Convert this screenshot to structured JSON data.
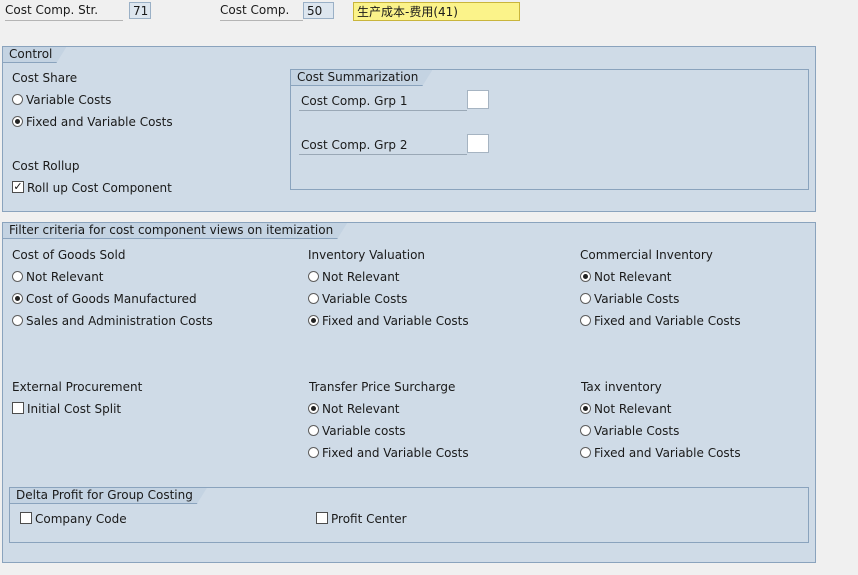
{
  "header": {
    "struct_label": "Cost Comp. Str.",
    "struct_value": "71",
    "comp_label": "Cost Comp.",
    "comp_value": "50",
    "comp_desc": "生产成本-费用(41)"
  },
  "control": {
    "title": "Control",
    "cost_share": {
      "label": "Cost Share",
      "options": [
        "Variable Costs",
        "Fixed and Variable Costs"
      ],
      "selected": "Fixed and Variable Costs"
    },
    "cost_rollup": {
      "label": "Cost Rollup",
      "checkbox_label": "Roll up Cost Component",
      "checked": true
    },
    "summarization": {
      "title": "Cost Summarization",
      "grp1_label": "Cost Comp. Grp 1",
      "grp1_value": "",
      "grp2_label": "Cost Comp. Grp 2",
      "grp2_value": ""
    }
  },
  "filter": {
    "title": "Filter criteria for cost component views on itemization",
    "cogs": {
      "label": "Cost of Goods Sold",
      "options": [
        "Not Relevant",
        "Cost of Goods Manufactured",
        "Sales and Administration Costs"
      ],
      "selected": "Cost of Goods Manufactured"
    },
    "inventory_valuation": {
      "label": "Inventory Valuation",
      "options": [
        "Not Relevant",
        "Variable Costs",
        "Fixed and Variable Costs"
      ],
      "selected": "Fixed and Variable Costs"
    },
    "commercial_inventory": {
      "label": "Commercial Inventory",
      "options": [
        "Not Relevant",
        "Variable Costs",
        "Fixed and Variable Costs"
      ],
      "selected": "Not Relevant"
    },
    "external_procurement": {
      "label": "External Procurement",
      "checkbox_label": "Initial Cost Split",
      "checked": false
    },
    "transfer_price": {
      "label": "Transfer Price Surcharge",
      "options": [
        "Not Relevant",
        "Variable costs",
        "Fixed and Variable Costs"
      ],
      "selected": "Not Relevant"
    },
    "tax_inventory": {
      "label": "Tax inventory",
      "options": [
        "Not Relevant",
        "Variable Costs",
        "Fixed and Variable Costs"
      ],
      "selected": "Not Relevant"
    },
    "delta_profit": {
      "title": "Delta Profit for Group Costing",
      "company_code_label": "Company Code",
      "company_code_checked": false,
      "profit_center_label": "Profit Center",
      "profit_center_checked": false
    }
  }
}
